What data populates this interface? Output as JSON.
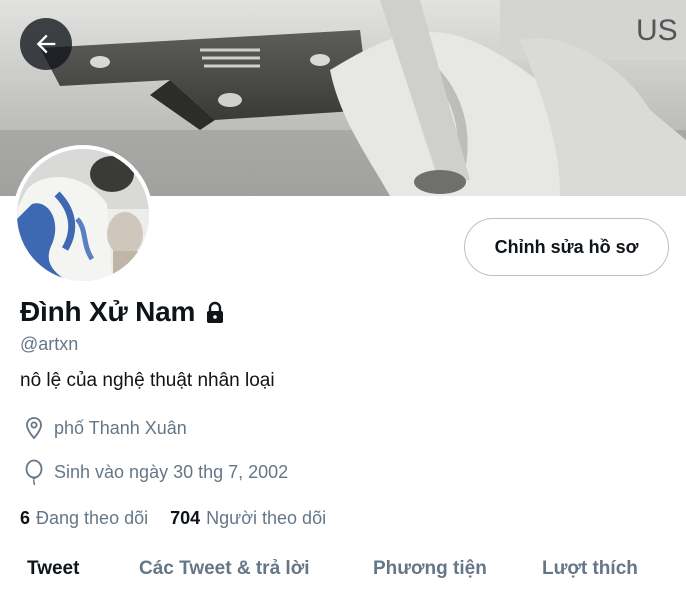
{
  "profile": {
    "display_name": "Đình Xử Nam",
    "handle": "@artxn",
    "bio": "nô lệ của nghệ thuật nhân loại",
    "location": "phố Thanh Xuân",
    "birthday": "Sinh vào ngày 30 thg 7, 2002",
    "protected_icon": "lock-icon"
  },
  "actions": {
    "edit_profile_label": "Chỉnh sửa hồ sơ",
    "back_icon": "arrow-left-icon"
  },
  "stats": {
    "following_count": "6",
    "following_label": "Đang theo dõi",
    "followers_count": "704",
    "followers_label": "Người theo dõi"
  },
  "tabs": [
    {
      "label": "Tweet",
      "active": true
    },
    {
      "label": "Các Tweet & trả lời",
      "active": false
    },
    {
      "label": "Phương tiện",
      "active": false
    },
    {
      "label": "Lượt thích",
      "active": false
    }
  ],
  "colors": {
    "text_primary": "#0f1419",
    "text_secondary": "#657786",
    "border": "#b9c1c8"
  }
}
